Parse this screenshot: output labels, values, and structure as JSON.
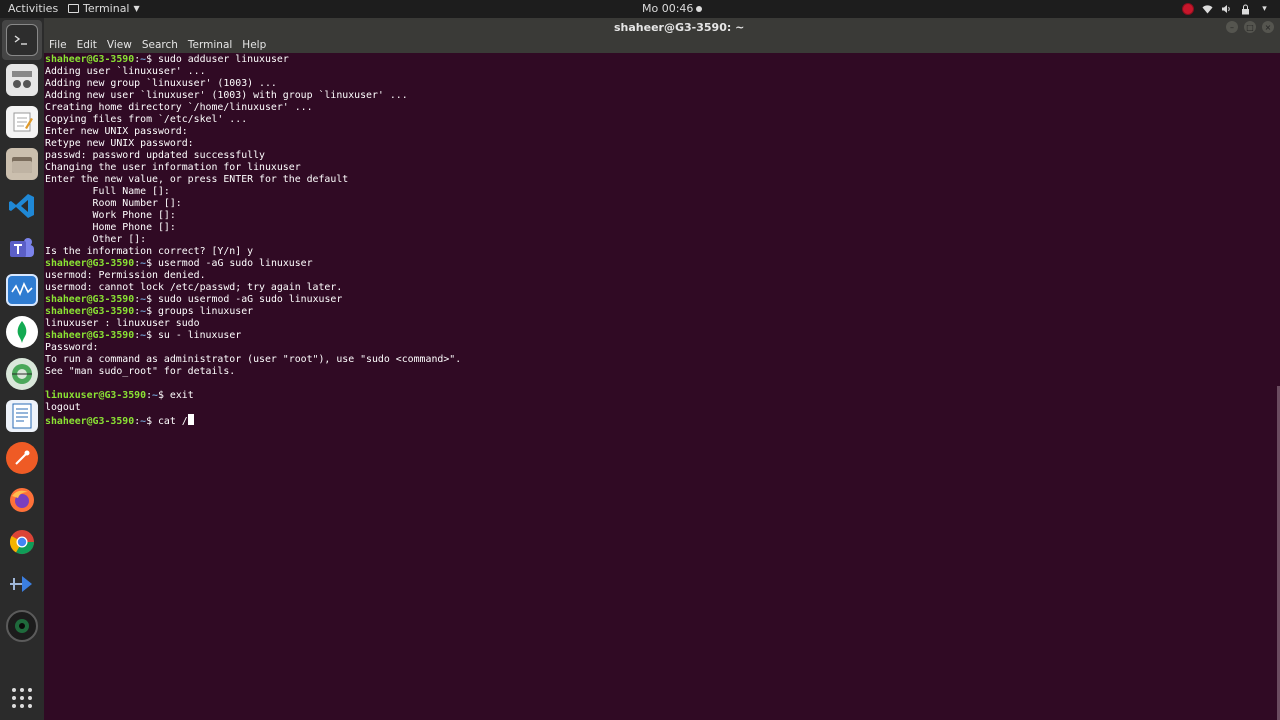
{
  "topbar": {
    "activities": "Activities",
    "app_name": "Terminal",
    "clock": "Mo 00:46"
  },
  "window": {
    "title": "shaheer@G3-3590: ~"
  },
  "menu": [
    "File",
    "Edit",
    "View",
    "Search",
    "Terminal",
    "Help"
  ],
  "dock": [
    {
      "name": "terminal",
      "color": "#2d2d2d"
    },
    {
      "name": "system-monitor",
      "color": "#e8e8e8"
    },
    {
      "name": "text-editor",
      "color": "#f2f2f2"
    },
    {
      "name": "files",
      "color": "#d9d0c2"
    },
    {
      "name": "vscode",
      "color": "#1f88d6"
    },
    {
      "name": "teams",
      "color": "#5b5fc7"
    },
    {
      "name": "monitor",
      "color": "#2f7cd1"
    },
    {
      "name": "mongodb",
      "color": "#ffffff"
    },
    {
      "name": "gnome-tweaks",
      "color": "#4aa85a"
    },
    {
      "name": "document-viewer",
      "color": "#2a6bb6"
    },
    {
      "name": "postman",
      "color": "#ef5b25"
    },
    {
      "name": "firefox",
      "color": "#ff7139"
    },
    {
      "name": "chrome",
      "color": "#dd4b39"
    },
    {
      "name": "anydesk",
      "color": "#3b7ee0"
    },
    {
      "name": "camera",
      "color": "#1c1c1c"
    },
    {
      "name": "show-applications",
      "color": "#2b2b2b"
    }
  ],
  "terminal": {
    "lines": [
      {
        "type": "prompt",
        "user": "shaheer@G3-3590",
        "path": "~",
        "cmd": " sudo adduser linuxuser"
      },
      {
        "type": "out",
        "text": "Adding user `linuxuser' ..."
      },
      {
        "type": "out",
        "text": "Adding new group `linuxuser' (1003) ..."
      },
      {
        "type": "out",
        "text": "Adding new user `linuxuser' (1003) with group `linuxuser' ..."
      },
      {
        "type": "out",
        "text": "Creating home directory `/home/linuxuser' ..."
      },
      {
        "type": "out",
        "text": "Copying files from `/etc/skel' ..."
      },
      {
        "type": "out",
        "text": "Enter new UNIX password:"
      },
      {
        "type": "out",
        "text": "Retype new UNIX password:"
      },
      {
        "type": "out",
        "text": "passwd: password updated successfully"
      },
      {
        "type": "out",
        "text": "Changing the user information for linuxuser"
      },
      {
        "type": "out",
        "text": "Enter the new value, or press ENTER for the default"
      },
      {
        "type": "out",
        "text": "        Full Name []:"
      },
      {
        "type": "out",
        "text": "        Room Number []:"
      },
      {
        "type": "out",
        "text": "        Work Phone []:"
      },
      {
        "type": "out",
        "text": "        Home Phone []:"
      },
      {
        "type": "out",
        "text": "        Other []:"
      },
      {
        "type": "out",
        "text": "Is the information correct? [Y/n] y"
      },
      {
        "type": "prompt",
        "user": "shaheer@G3-3590",
        "path": "~",
        "cmd": " usermod -aG sudo linuxuser"
      },
      {
        "type": "out",
        "text": "usermod: Permission denied."
      },
      {
        "type": "out",
        "text": "usermod: cannot lock /etc/passwd; try again later."
      },
      {
        "type": "prompt",
        "user": "shaheer@G3-3590",
        "path": "~",
        "cmd": " sudo usermod -aG sudo linuxuser"
      },
      {
        "type": "prompt",
        "user": "shaheer@G3-3590",
        "path": "~",
        "cmd": " groups linuxuser"
      },
      {
        "type": "out",
        "text": "linuxuser : linuxuser sudo"
      },
      {
        "type": "prompt",
        "user": "shaheer@G3-3590",
        "path": "~",
        "cmd": " su - linuxuser"
      },
      {
        "type": "out",
        "text": "Password:"
      },
      {
        "type": "out",
        "text": "To run a command as administrator (user \"root\"), use \"sudo <command>\"."
      },
      {
        "type": "out",
        "text": "See \"man sudo_root\" for details."
      },
      {
        "type": "out",
        "text": ""
      },
      {
        "type": "prompt",
        "user": "linuxuser@G3-3590",
        "path": "~",
        "cmd": " exit"
      },
      {
        "type": "out",
        "text": "logout"
      },
      {
        "type": "prompt",
        "user": "shaheer@G3-3590",
        "path": "~",
        "cmd": " cat /",
        "cursor": true
      }
    ]
  }
}
